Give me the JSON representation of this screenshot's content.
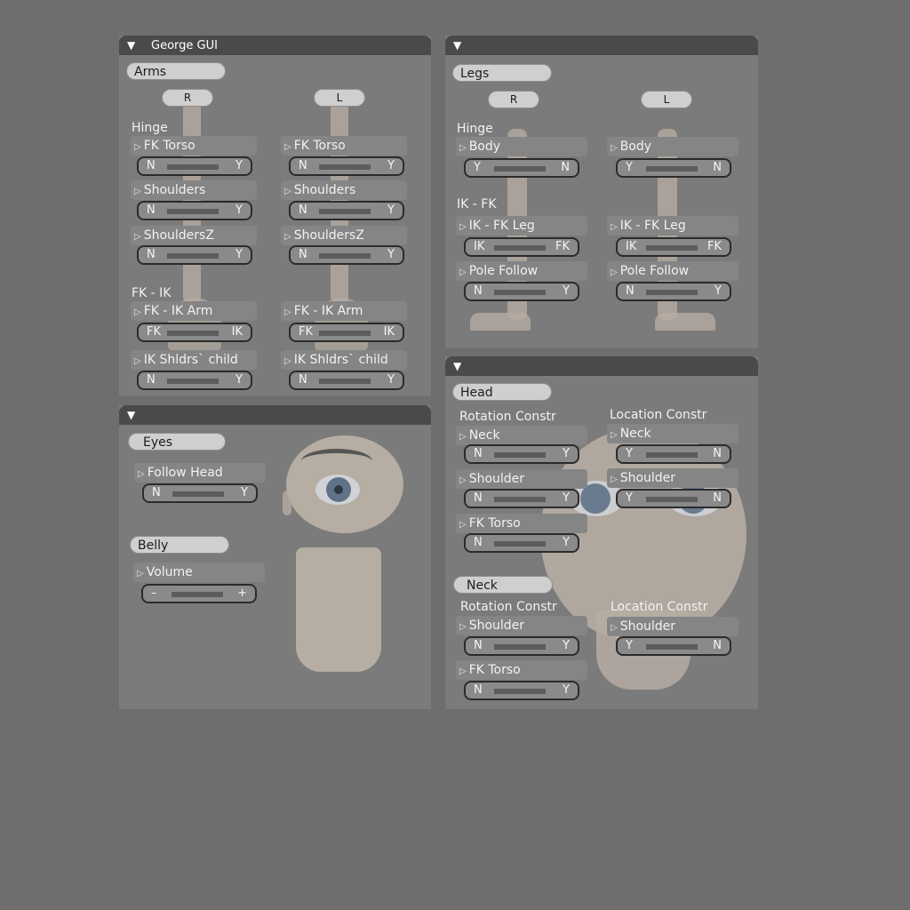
{
  "arms_panel": {
    "title": "George GUI",
    "group_label": "Arms",
    "side_r": "R",
    "side_l": "L",
    "section_hinge": "Hinge",
    "section_fkik": "FK - IK",
    "hinge_params": [
      {
        "name": "FK Torso",
        "lo": "N",
        "hi": "Y"
      },
      {
        "name": "Shoulders",
        "lo": "N",
        "hi": "Y"
      },
      {
        "name": "ShouldersZ",
        "lo": "N",
        "hi": "Y"
      }
    ],
    "fkik_params": [
      {
        "name": "FK - IK Arm",
        "lo": "FK",
        "hi": "IK"
      },
      {
        "name": "IK Shldrs` child",
        "lo": "N",
        "hi": "Y"
      }
    ]
  },
  "legs_panel": {
    "group_label": "Legs",
    "side_r": "R",
    "side_l": "L",
    "section_hinge": "Hinge",
    "section_ikfk": "IK - FK",
    "hinge_params": [
      {
        "name": "Body",
        "lo": "Y",
        "hi": "N"
      }
    ],
    "ikfk_params": [
      {
        "name": "IK - FK Leg",
        "lo": "IK",
        "hi": "FK"
      },
      {
        "name": "Pole Follow",
        "lo": "N",
        "hi": "Y"
      }
    ]
  },
  "eyes_panel": {
    "group_eyes": "Eyes",
    "follow_head": {
      "name": "Follow Head",
      "lo": "N",
      "hi": "Y"
    },
    "group_belly": "Belly",
    "volume": {
      "name": "Volume",
      "lo": "–",
      "hi": "+"
    }
  },
  "head_panel": {
    "group_head": "Head",
    "rotation_constr": "Rotation Constr",
    "location_constr": "Location Constr",
    "head_rotation": [
      {
        "name": "Neck",
        "lo": "N",
        "hi": "Y"
      },
      {
        "name": "Shoulder",
        "lo": "N",
        "hi": "Y"
      },
      {
        "name": "FK Torso",
        "lo": "N",
        "hi": "Y"
      }
    ],
    "head_location": [
      {
        "name": "Neck",
        "lo": "Y",
        "hi": "N"
      },
      {
        "name": "Shoulder",
        "lo": "Y",
        "hi": "N"
      }
    ],
    "group_neck": "Neck",
    "neck_rotation": [
      {
        "name": "Shoulder",
        "lo": "N",
        "hi": "Y"
      },
      {
        "name": "FK Torso",
        "lo": "N",
        "hi": "Y"
      }
    ],
    "neck_location": [
      {
        "name": "Shoulder",
        "lo": "Y",
        "hi": "N"
      }
    ]
  },
  "icons": {
    "collapse": "▼",
    "expand": "▷"
  },
  "colors": {
    "background": "#6e6e6e",
    "panel": "#7b7b7b",
    "header": "#4a4a4a",
    "skin": "#b6ada3"
  }
}
